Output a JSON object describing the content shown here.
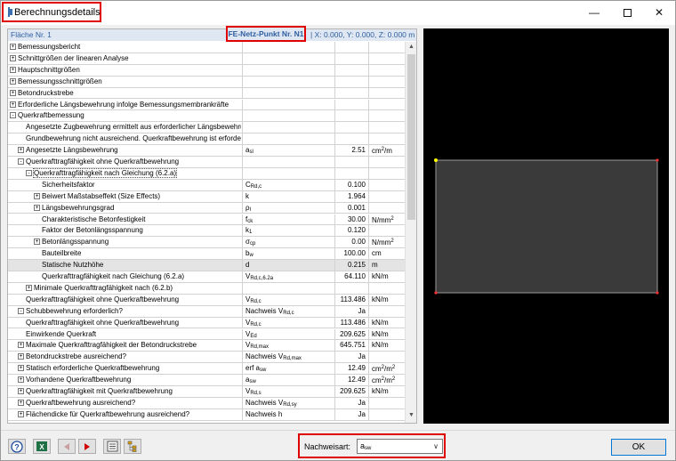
{
  "window": {
    "title": "Berechnungsdetails"
  },
  "infobar": {
    "left": "Fläche Nr. 1",
    "point": "FE-Netz-Punkt Nr. N1",
    "coords": "| X: 0.000, Y: 0.000, Z: 0.000 m"
  },
  "rows": [
    {
      "indent": 0,
      "exp": "+",
      "label": "Bemessungsbericht",
      "sym": "",
      "val": "",
      "unit": ""
    },
    {
      "indent": 0,
      "exp": "+",
      "label": "Schnittgrößen der linearen Analyse",
      "sym": "",
      "val": "",
      "unit": ""
    },
    {
      "indent": 0,
      "exp": "+",
      "label": "Hauptschnittgrößen",
      "sym": "",
      "val": "",
      "unit": ""
    },
    {
      "indent": 0,
      "exp": "+",
      "label": "Bemessungsschnittgrößen",
      "sym": "",
      "val": "",
      "unit": ""
    },
    {
      "indent": 0,
      "exp": "+",
      "label": "Betondruckstrebe",
      "sym": "",
      "val": "",
      "unit": ""
    },
    {
      "indent": 0,
      "exp": "+",
      "label": "Erforderliche Längsbewehrung infolge Bemessungsmembrankräfte",
      "sym": "",
      "val": "",
      "unit": ""
    },
    {
      "indent": 0,
      "exp": "-",
      "label": "Querkraftbemessung",
      "sym": "",
      "val": "",
      "unit": ""
    },
    {
      "indent": 2,
      "exp": "",
      "label": "Angesetzte Zugbewehrung ermittelt aus erforderlicher Längsbewehrung.",
      "sym": "",
      "val": "",
      "unit": ""
    },
    {
      "indent": 2,
      "exp": "",
      "label": "Grundbewehrung nicht ausreichend. Querkraftbewehrung ist erforderlich.",
      "sym": "",
      "val": "",
      "unit": ""
    },
    {
      "indent": 1,
      "exp": "+",
      "label": "Angesetzte Längsbewehrung",
      "sym": "a",
      "symsub": "sl",
      "val": "2.51",
      "unit": "cm",
      "unitsup": "2",
      "unittail": "/m"
    },
    {
      "indent": 1,
      "exp": "-",
      "label": "Querkrafttragfähigkeit ohne Querkraftbewehrung",
      "sym": "",
      "val": "",
      "unit": ""
    },
    {
      "indent": 2,
      "exp": "-",
      "label": "Querkrafttragfähigkeit nach Gleichung (6.2.a)",
      "sym": "",
      "val": "",
      "unit": "",
      "sel": true
    },
    {
      "indent": 4,
      "exp": "",
      "label": "Sicherheitsfaktor",
      "sym": "C",
      "symsub": "Rd,c",
      "val": "0.100",
      "unit": ""
    },
    {
      "indent": 3,
      "exp": "+",
      "label": "Beiwert Maßstabseffekt (Size Effects)",
      "sym": "k",
      "val": "1.964",
      "unit": ""
    },
    {
      "indent": 3,
      "exp": "+",
      "label": "Längsbewehrungsgrad",
      "sym": "ρ",
      "symsub": "l",
      "val": "0.001",
      "unit": ""
    },
    {
      "indent": 4,
      "exp": "",
      "label": "Charakteristische Betonfestigkeit",
      "sym": "f",
      "symsub": "ck",
      "val": "30.00",
      "unit": "N/mm",
      "unitsup": "2"
    },
    {
      "indent": 4,
      "exp": "",
      "label": "Faktor der Betonlängsspannung",
      "sym": "k",
      "symsub": "1",
      "val": "0.120",
      "unit": ""
    },
    {
      "indent": 3,
      "exp": "+",
      "label": "Betonlängsspannung",
      "sym": "σ",
      "symsub": "cp",
      "val": "0.00",
      "unit": "N/mm",
      "unitsup": "2"
    },
    {
      "indent": 4,
      "exp": "",
      "label": "Bauteilbreite",
      "sym": "b",
      "symsub": "w",
      "val": "100.00",
      "unit": "cm"
    },
    {
      "indent": 4,
      "exp": "",
      "label": "Statische Nutzhöhe",
      "sym": "d",
      "val": "0.215",
      "unit": "m",
      "hl": true
    },
    {
      "indent": 4,
      "exp": "",
      "label": "Querkrafttragfähigkeit nach Gleichung (6.2.a)",
      "sym": "V",
      "symsub": "Rd,c,6.2a",
      "val": "64.110",
      "unit": "kN/m"
    },
    {
      "indent": 2,
      "exp": "+",
      "label": "Minimale Querkrafttragfähigkeit nach (6.2.b)",
      "sym": "",
      "val": "",
      "unit": ""
    },
    {
      "indent": 2,
      "exp": "",
      "label": "Querkrafttragfähigkeit ohne Querkraftbewehrung",
      "sym": "V",
      "symsub": "Rd,c",
      "val": "113.486",
      "unit": "kN/m"
    },
    {
      "indent": 1,
      "exp": "-",
      "label": "Schubbewehrung erforderlich?",
      "sym": "Nachweis V",
      "symsub": "Rd,c",
      "val": "Ja",
      "unit": ""
    },
    {
      "indent": 2,
      "exp": "",
      "label": "Querkrafttragfähigkeit ohne Querkraftbewehrung",
      "sym": "V",
      "symsub": "Rd,c",
      "val": "113.486",
      "unit": "kN/m"
    },
    {
      "indent": 2,
      "exp": "",
      "label": "Einwirkende Querkraft",
      "sym": "V",
      "symsub": "Ed",
      "val": "209.625",
      "unit": "kN/m"
    },
    {
      "indent": 1,
      "exp": "+",
      "label": "Maximale Querkrafttragfähigkeit der Betondruckstrebe",
      "sym": "V",
      "symsub": "Rd,max",
      "val": "645.751",
      "unit": "kN/m"
    },
    {
      "indent": 1,
      "exp": "+",
      "label": "Betondruckstrebe ausreichend?",
      "sym": "Nachweis V",
      "symsub": "Rd,max",
      "val": "Ja",
      "unit": ""
    },
    {
      "indent": 1,
      "exp": "+",
      "label": "Statisch erforderliche Querkraftbewehrung",
      "sym": "erf a",
      "symsub": "sw",
      "val": "12.49",
      "unit": "cm",
      "unitsup": "2",
      "unittail": "/m",
      "unitsup2": "2"
    },
    {
      "indent": 1,
      "exp": "+",
      "label": "Vorhandene Querkraftbewehrung",
      "sym": "a",
      "symsub": "sw",
      "val": "12.49",
      "unit": "cm",
      "unitsup": "2",
      "unittail": "/m",
      "unitsup2": "2"
    },
    {
      "indent": 1,
      "exp": "+",
      "label": "Querkrafttragfähigkeit mit Querkraftbewehrung",
      "sym": "V",
      "symsub": "Rd,s",
      "val": "209.625",
      "unit": "kN/m"
    },
    {
      "indent": 1,
      "exp": "+",
      "label": "Querkraftbewehrung ausreichend?",
      "sym": "Nachweis V",
      "symsub": "Rd,sy",
      "val": "Ja",
      "unit": ""
    },
    {
      "indent": 1,
      "exp": "+",
      "label": "Flächendicke für Querkraftbewehrung ausreichend?",
      "sym": "Nachweis h",
      "val": "Ja",
      "unit": ""
    }
  ],
  "bottom": {
    "nachweis_label": "Nachweisart:",
    "nachweis_value": "a",
    "nachweis_sub": "sw",
    "ok_label": "OK"
  },
  "colors": {
    "accent_red": "#e00000",
    "info_blue": "#2f5fa0",
    "graphic_bg": "#000000"
  }
}
